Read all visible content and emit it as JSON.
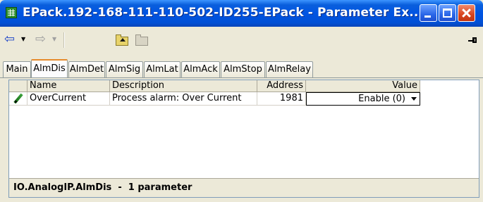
{
  "window": {
    "title": "EPack.192-168-111-110-502-ID255-EPack - Parameter Ex..."
  },
  "toolbar": {
    "back_icon": "back-arrow-icon",
    "forward_icon": "forward-arrow-icon",
    "dropdown_glyph": "▼",
    "back_glyph": "⇦",
    "forward_glyph": "⇨"
  },
  "tabs": [
    {
      "label": "Main",
      "active": false
    },
    {
      "label": "AlmDis",
      "active": true
    },
    {
      "label": "AlmDet",
      "active": false
    },
    {
      "label": "AlmSig",
      "active": false
    },
    {
      "label": "AlmLat",
      "active": false
    },
    {
      "label": "AlmAck",
      "active": false
    },
    {
      "label": "AlmStop",
      "active": false
    },
    {
      "label": "AlmRelay",
      "active": false
    }
  ],
  "grid": {
    "columns": [
      "Name",
      "Description",
      "Address",
      "Value"
    ],
    "rows": [
      {
        "name": "OverCurrent",
        "description": "Process alarm: Over Current",
        "address": "1981",
        "value": "Enable (0)"
      }
    ]
  },
  "status": {
    "text": "IO.AnalogIP.AlmDis  -  1 parameter"
  },
  "colors": {
    "titlebar": "#0054e3",
    "active_tab_accent": "#e68b2c",
    "close_button": "#d8441f"
  }
}
